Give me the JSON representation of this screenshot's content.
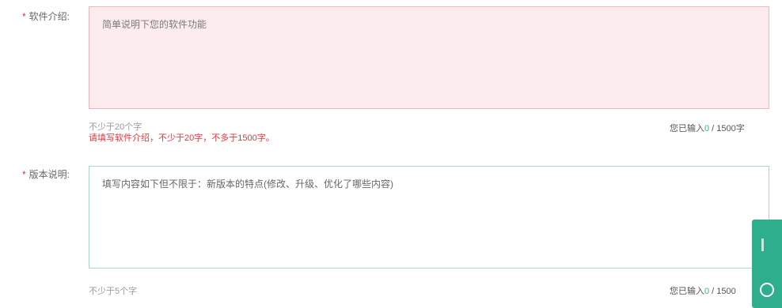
{
  "software_intro": {
    "required_mark": "*",
    "label": "软件介绍:",
    "placeholder": "简单说明下您的软件功能",
    "hint": "不少于20个字",
    "error": "请填写软件介绍，不少于20字，不多于1500字。",
    "counter_prefix": "您已输入",
    "counter_value": "0",
    "counter_suffix": " / 1500字"
  },
  "version_note": {
    "required_mark": "*",
    "label": "版本说明:",
    "placeholder": "填写内容如下但不限于：新版本的特点(修改、升级、优化了哪些内容)",
    "hint": "不少于5个字",
    "counter_prefix": "您已输入",
    "counter_value": "0",
    "counter_suffix": " / 1500"
  },
  "colors": {
    "required": "#e5353b",
    "error_field_bg": "#fdecee",
    "error_field_border": "#f2b5bd",
    "focus_field_border": "#a7d8cc",
    "counter_accent": "#2db48b",
    "float_tab": "#2fae8e"
  },
  "float_tab": {
    "icon": "feedback-icon"
  }
}
